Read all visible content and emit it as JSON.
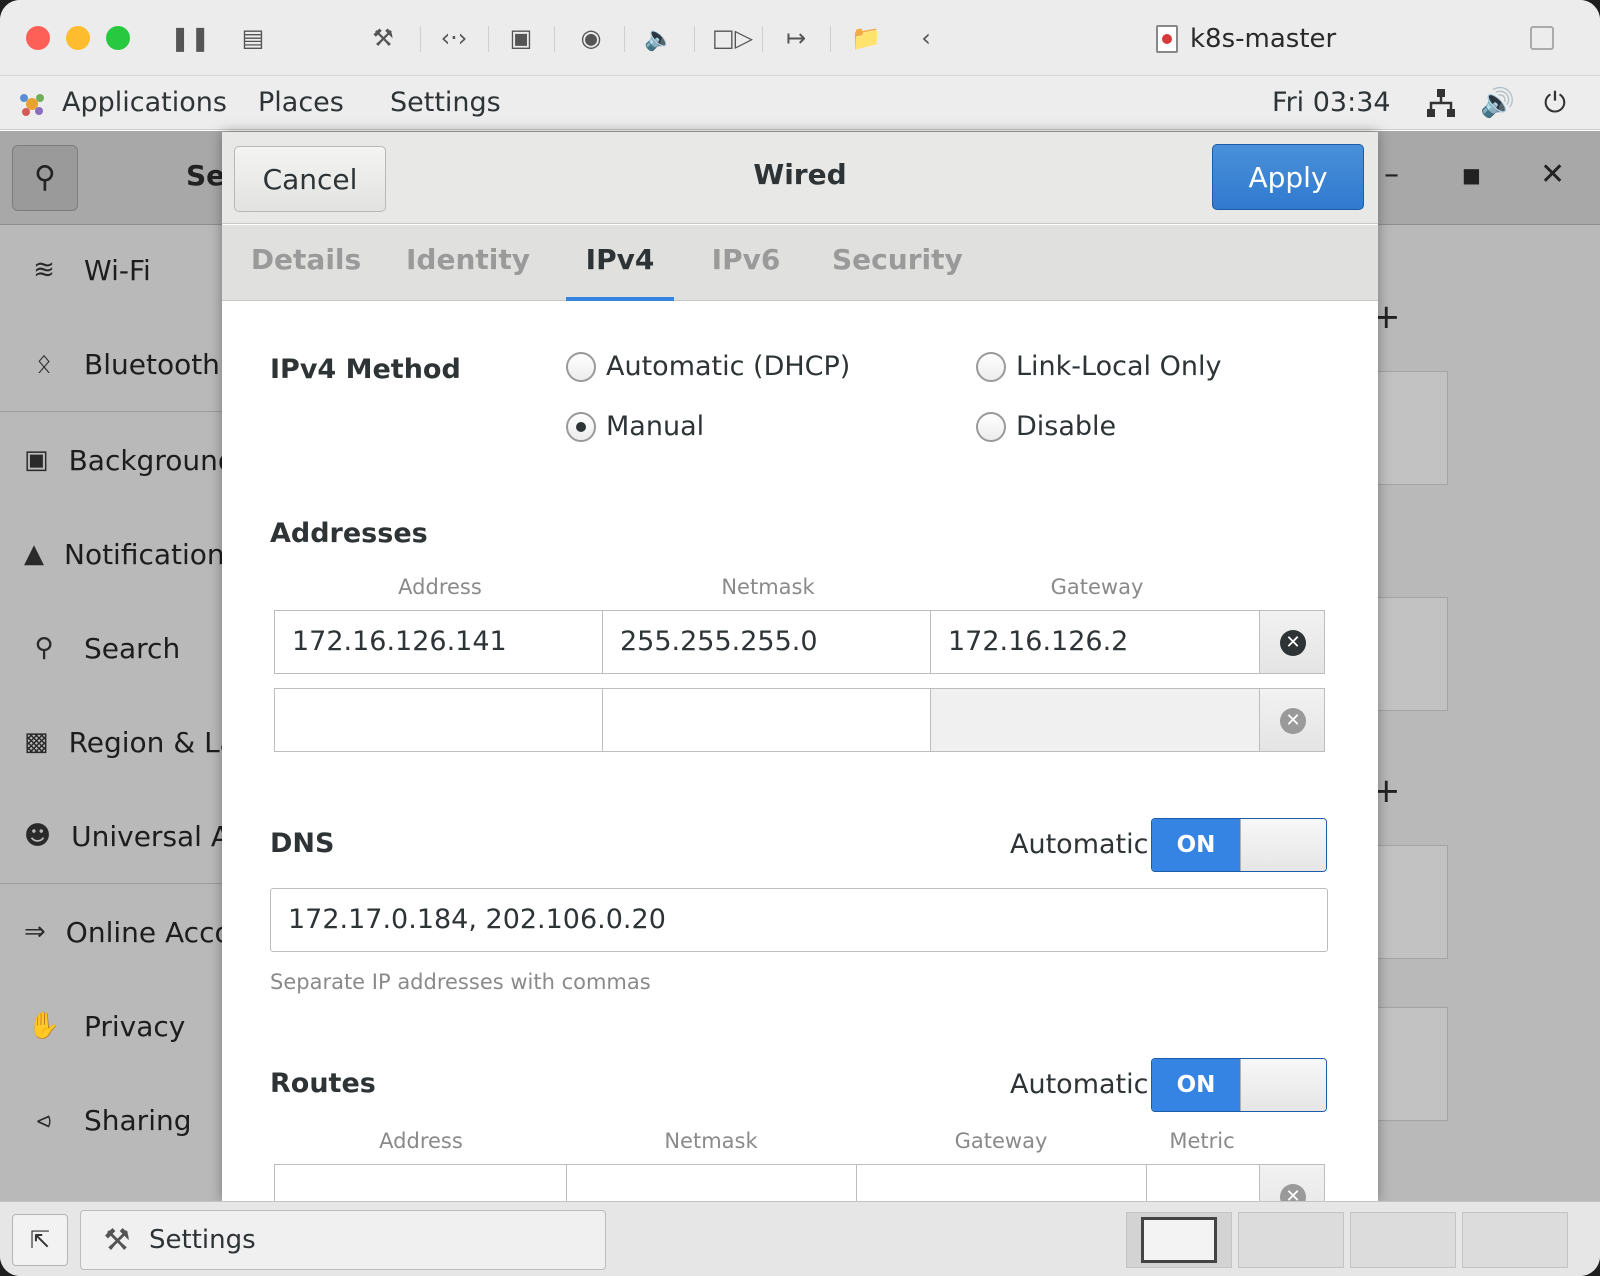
{
  "vm": {
    "title": "k8s-master",
    "toolbar_icons": [
      "pause-icon",
      "snapshot-icon",
      "wrench-icon",
      "code-icon",
      "disk-icon",
      "camera-icon",
      "sound-icon",
      "video-icon",
      "usb-icon",
      "folder-share-icon",
      "back-chevron-icon"
    ]
  },
  "panel": {
    "applications": "Applications",
    "places": "Places",
    "settings": "Settings",
    "clock": "Fri 03:34"
  },
  "settings_window": {
    "title_partial": "Se",
    "sidebar": [
      {
        "label": "Wi-Fi",
        "icon": "wifi-icon"
      },
      {
        "label": "Bluetooth",
        "icon": "bluetooth-icon"
      },
      {
        "label": "Background",
        "icon": "background-icon"
      },
      {
        "label": "Notifications",
        "icon": "bell-icon"
      },
      {
        "label": "Search",
        "icon": "search-icon"
      },
      {
        "label": "Region & Language",
        "icon": "region-icon"
      },
      {
        "label": "Universal Access",
        "icon": "accessibility-icon"
      },
      {
        "label": "Online Accounts",
        "icon": "online-accounts-icon"
      },
      {
        "label": "Privacy",
        "icon": "hand-icon"
      },
      {
        "label": "Sharing",
        "icon": "share-icon"
      }
    ]
  },
  "dialog": {
    "cancel": "Cancel",
    "title": "Wired",
    "apply": "Apply",
    "tabs": [
      "Details",
      "Identity",
      "IPv4",
      "IPv6",
      "Security"
    ],
    "active_tab": "IPv4",
    "method": {
      "label": "IPv4 Method",
      "options": [
        "Automatic (DHCP)",
        "Link-Local Only",
        "Manual",
        "Disable"
      ],
      "selected": "Manual"
    },
    "addresses": {
      "label": "Addresses",
      "columns": [
        "Address",
        "Netmask",
        "Gateway"
      ],
      "rows": [
        {
          "address": "172.16.126.141",
          "netmask": "255.255.255.0",
          "gateway": "172.16.126.2"
        },
        {
          "address": "",
          "netmask": "",
          "gateway": ""
        }
      ]
    },
    "dns": {
      "label": "DNS",
      "automatic_label": "Automatic",
      "switch": "ON",
      "value": "172.17.0.184, 202.106.0.20",
      "hint": "Separate IP addresses with commas"
    },
    "routes": {
      "label": "Routes",
      "automatic_label": "Automatic",
      "switch": "ON",
      "columns": [
        "Address",
        "Netmask",
        "Gateway",
        "Metric"
      ]
    }
  },
  "taskbar": {
    "window_label": "Settings"
  },
  "colors": {
    "accent": "#3584e4",
    "apply": "#3079cf",
    "close_red": "#fe5f57",
    "minimize_yellow": "#febc2e",
    "zoom_green": "#28c840"
  }
}
